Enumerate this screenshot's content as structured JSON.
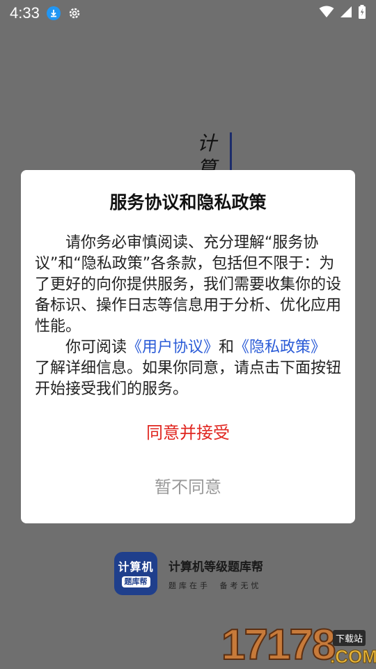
{
  "status_bar": {
    "time": "4:33"
  },
  "splash": {
    "vertical_title": "计算",
    "brand": {
      "logo_line1": "计算机",
      "logo_line2": "题库帮",
      "name": "计算机等级题库帮",
      "slogan": "题库在手 备考无忧"
    }
  },
  "watermark": {
    "number": "17178",
    "tag": "下载站",
    "suffix": ".COM"
  },
  "dialog": {
    "title": "服务协议和隐私政策",
    "paragraph1": "请你务必审慎阅读、充分理解“服务协议”和“隐私政策”各条款，包括但不限于：为了更好的向你提供服务，我们需要收集你的设备标识、操作日志等信息用于分析、优化应用性能。",
    "p2_prefix": "你可阅读",
    "user_agreement_link": "《用户协议》",
    "p2_and": "和",
    "privacy_policy_link": "《隐私政策》",
    "p2_suffix": "了解详细信息。如果你同意，请点击下面按钮开始接受我们的服务。",
    "agree_label": "同意并接受",
    "decline_label": "暂不同意"
  },
  "colors": {
    "overlay": "#6f6f6f",
    "agree": "#e0251f",
    "decline": "#999999",
    "link": "#2a5bd7"
  }
}
